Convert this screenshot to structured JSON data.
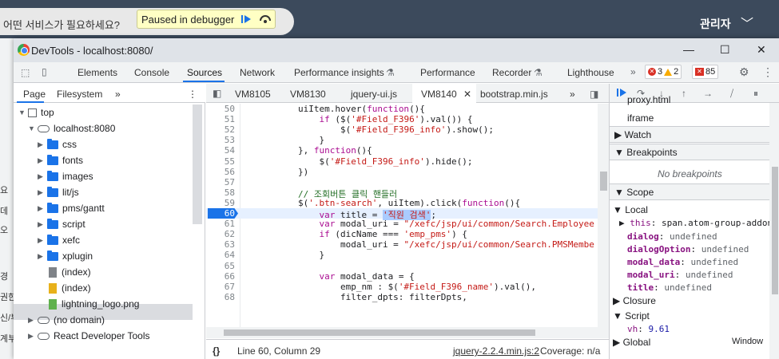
{
  "background": {
    "question": "어떤 서비스가 필요하세요?",
    "admin_label": "관리자",
    "side_fragments": [
      "요",
      "데",
      "오",
      "경",
      "권한",
      "신/부",
      "계부"
    ]
  },
  "debugger_banner": {
    "text": "Paused in debugger"
  },
  "window": {
    "title": "DevTools - localhost:8080/"
  },
  "tabs": [
    "Elements",
    "Console",
    "Sources",
    "Network",
    "Performance insights",
    "Performance",
    "Recorder",
    "Lighthouse"
  ],
  "active_tab": "Sources",
  "counts": {
    "errors": "3",
    "warnings": "2",
    "issues": "85"
  },
  "navigator": {
    "tabs": [
      "Page",
      "Filesystem"
    ],
    "tree": [
      {
        "label": "top",
        "type": "box",
        "depth": 0,
        "arrow": "▼"
      },
      {
        "label": "localhost:8080",
        "type": "cloud",
        "depth": 1,
        "arrow": "▼"
      },
      {
        "label": "css",
        "type": "folder",
        "depth": 2,
        "arrow": "▶"
      },
      {
        "label": "fonts",
        "type": "folder",
        "depth": 2,
        "arrow": "▶"
      },
      {
        "label": "images",
        "type": "folder",
        "depth": 2,
        "arrow": "▶"
      },
      {
        "label": "lit/js",
        "type": "folder",
        "depth": 2,
        "arrow": "▶"
      },
      {
        "label": "pms/gantt",
        "type": "folder",
        "depth": 2,
        "arrow": "▶"
      },
      {
        "label": "script",
        "type": "folder",
        "depth": 2,
        "arrow": "▶"
      },
      {
        "label": "xefc",
        "type": "folder",
        "depth": 2,
        "arrow": "▶"
      },
      {
        "label": "xplugin",
        "type": "folder",
        "depth": 2,
        "arrow": "▶"
      },
      {
        "label": "(index)",
        "type": "file-grey",
        "depth": 2,
        "arrow": ""
      },
      {
        "label": "(index)",
        "type": "file-yellow",
        "depth": 2,
        "arrow": ""
      },
      {
        "label": "lightning_logo.png",
        "type": "file-green",
        "depth": 2,
        "arrow": ""
      },
      {
        "label": "(no domain)",
        "type": "cloud",
        "depth": 1,
        "arrow": "▶"
      },
      {
        "label": "React Developer Tools",
        "type": "cloud",
        "depth": 1,
        "arrow": "▶"
      }
    ]
  },
  "editor": {
    "tabs": [
      "VM8105",
      "VM8130",
      "jquery-ui.js",
      "VM8140",
      "bootstrap.min.js"
    ],
    "lines": [
      {
        "n": "50",
        "segs": [
          [
            "",
            "        uiItem.hover("
          ],
          [
            "kw",
            "function"
          ],
          [
            "",
            "(){"
          ]
        ]
      },
      {
        "n": "51",
        "segs": [
          [
            "",
            "            "
          ],
          [
            "kw",
            "if"
          ],
          [
            "",
            " ($("
          ],
          [
            "str",
            "'#Field_F396'"
          ],
          [
            "",
            ").val()) {"
          ]
        ]
      },
      {
        "n": "52",
        "segs": [
          [
            "",
            "                $("
          ],
          [
            "str",
            "'#Field_F396_info'"
          ],
          [
            "",
            ").show();"
          ]
        ]
      },
      {
        "n": "53",
        "segs": [
          [
            "",
            "            }"
          ]
        ]
      },
      {
        "n": "54",
        "segs": [
          [
            "",
            "        }, "
          ],
          [
            "kw",
            "function"
          ],
          [
            "",
            "(){"
          ]
        ]
      },
      {
        "n": "55",
        "segs": [
          [
            "",
            "            $("
          ],
          [
            "str",
            "'#Field_F396_info'"
          ],
          [
            "",
            ").hide();"
          ]
        ]
      },
      {
        "n": "56",
        "segs": [
          [
            "",
            "        })"
          ]
        ]
      },
      {
        "n": "57",
        "segs": [
          [
            "",
            ""
          ]
        ]
      },
      {
        "n": "58",
        "segs": [
          [
            "cmt",
            "        // 조회버튼 클릭 핸들러"
          ]
        ]
      },
      {
        "n": "59",
        "segs": [
          [
            "",
            "        $("
          ],
          [
            "str",
            "'.btn-search'"
          ],
          [
            "",
            ", uiItem).click("
          ],
          [
            "kw",
            "function"
          ],
          [
            "",
            "(){"
          ]
        ]
      },
      {
        "n": "60",
        "segs": [
          [
            "",
            "            "
          ],
          [
            "kw",
            "var"
          ],
          [
            "",
            " title = "
          ],
          [
            "str hl",
            "'직원 검색'"
          ],
          [
            "",
            ";"
          ]
        ]
      },
      {
        "n": "61",
        "segs": [
          [
            "",
            "            "
          ],
          [
            "kw",
            "var"
          ],
          [
            "",
            " modal_uri = "
          ],
          [
            "str",
            "\"/xefc/jsp/ui/common/Search.Employee"
          ]
        ]
      },
      {
        "n": "62",
        "segs": [
          [
            "",
            "            "
          ],
          [
            "kw",
            "if"
          ],
          [
            "",
            " (dicName === "
          ],
          [
            "str",
            "'emp_pms'"
          ],
          [
            "",
            ") {"
          ]
        ]
      },
      {
        "n": "63",
        "segs": [
          [
            "",
            "                modal_uri = "
          ],
          [
            "str",
            "\"/xefc/jsp/ui/common/Search.PMSMembe"
          ]
        ]
      },
      {
        "n": "64",
        "segs": [
          [
            "",
            "            }"
          ]
        ]
      },
      {
        "n": "65",
        "segs": [
          [
            "",
            ""
          ]
        ]
      },
      {
        "n": "66",
        "segs": [
          [
            "",
            "            "
          ],
          [
            "kw",
            "var"
          ],
          [
            "",
            " modal_data = {"
          ]
        ]
      },
      {
        "n": "67",
        "segs": [
          [
            "",
            "                emp_nm : $("
          ],
          [
            "str",
            "'#Field_F396_name'"
          ],
          [
            "",
            ").val(),"
          ]
        ]
      },
      {
        "n": "68",
        "segs": [
          [
            "",
            "                filter_dpts: filterDpts,"
          ]
        ]
      }
    ],
    "current_line": "60",
    "status": {
      "brace": "{}",
      "position": "Line 60, Column 29",
      "source": "jquery-2.2.4.min.js:2",
      "coverage": "Coverage: n/a"
    }
  },
  "debugger": {
    "threads": [
      "proxy.html",
      "iframe"
    ],
    "watch_label": "Watch",
    "breakpoints_label": "Breakpoints",
    "no_breakpoints": "No breakpoints",
    "scope_label": "Scope",
    "local_label": "Local",
    "this_row": {
      "name": "this",
      "value": "span.atom-group-addon"
    },
    "locals": [
      {
        "name": "dialog",
        "value": "undefined"
      },
      {
        "name": "dialogOption",
        "value": "undefined"
      },
      {
        "name": "modal_data",
        "value": "undefined"
      },
      {
        "name": "modal_uri",
        "value": "undefined"
      },
      {
        "name": "title",
        "value": "undefined"
      }
    ],
    "closure_label": "Closure",
    "script_label": "Script",
    "script_var": {
      "name": "vh",
      "value": "9.61"
    },
    "global_label": "Global",
    "global_value": "Window"
  }
}
